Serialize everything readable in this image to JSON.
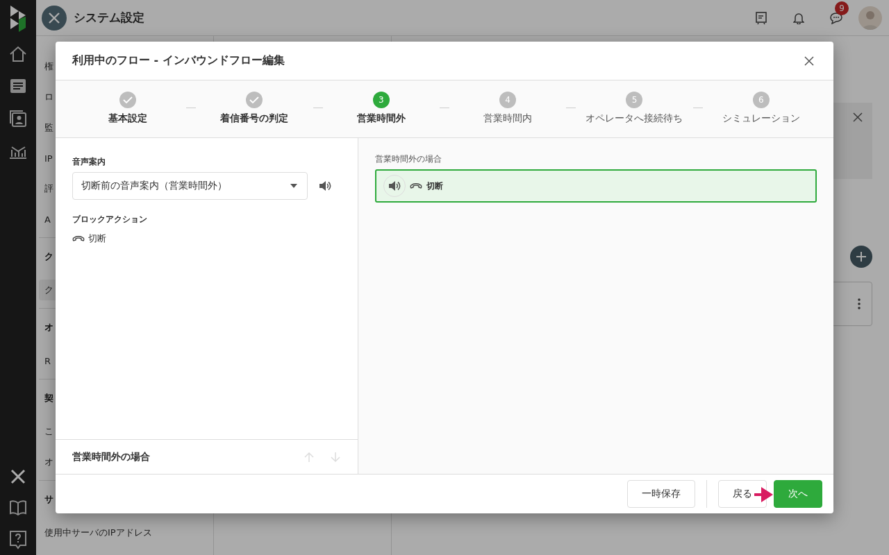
{
  "app": {
    "title": "システム設定",
    "notification_count": "9"
  },
  "sidebar": {
    "items": [
      {
        "kind": "item",
        "label": "権",
        "selected": false
      },
      {
        "kind": "item",
        "label": "ロ",
        "selected": false
      },
      {
        "kind": "item",
        "label": "監",
        "selected": false
      },
      {
        "kind": "item",
        "label": "IP",
        "selected": false
      },
      {
        "kind": "item",
        "label": "評",
        "selected": false
      },
      {
        "kind": "item",
        "label": "A",
        "selected": false
      },
      {
        "kind": "heading",
        "label": "ク"
      },
      {
        "kind": "item",
        "label": "ク",
        "selected": true
      },
      {
        "kind": "heading",
        "label": "オ"
      },
      {
        "kind": "item",
        "label": "R",
        "selected": false
      },
      {
        "kind": "heading",
        "label": "契"
      },
      {
        "kind": "item",
        "label": "こ",
        "selected": false
      },
      {
        "kind": "item",
        "label": "オ",
        "selected": false
      },
      {
        "kind": "heading",
        "label": "サ"
      },
      {
        "kind": "item",
        "label": "使用中サーバのIPアドレス",
        "selected": false
      }
    ]
  },
  "dialog": {
    "title": "利用中のフロー - インバウンドフロー編集",
    "steps": [
      {
        "label": "基本設定",
        "done": true,
        "selected": false
      },
      {
        "label": "着信番号の判定",
        "done": true,
        "selected": false
      },
      {
        "number": "3",
        "label": "営業時間外",
        "done": false,
        "selected": true
      },
      {
        "number": "4",
        "label": "営業時間内",
        "done": false,
        "selected": false
      },
      {
        "number": "5",
        "label": "オペレータへ接続待ち",
        "done": false,
        "selected": false
      },
      {
        "number": "6",
        "label": "シミュレーション",
        "done": false,
        "selected": false
      }
    ],
    "editor": {
      "voice_label": "音声案内",
      "voice_value": "切断前の音声案内（営業時間外）",
      "action_label": "ブロックアクション",
      "action": "切断",
      "block_title": "営業時間外の場合",
      "move_up_disabled": true,
      "move_down_disabled": true
    },
    "preview": {
      "label": "営業時間外の場合",
      "blocks": [
        {
          "action": "切断",
          "selected": true
        }
      ]
    },
    "buttons": [
      {
        "kind": "secondary",
        "label": "一時保存"
      },
      {
        "kind": "divider"
      },
      {
        "kind": "secondary",
        "label": "戻る"
      },
      {
        "kind": "primary",
        "label": "次へ"
      }
    ]
  }
}
